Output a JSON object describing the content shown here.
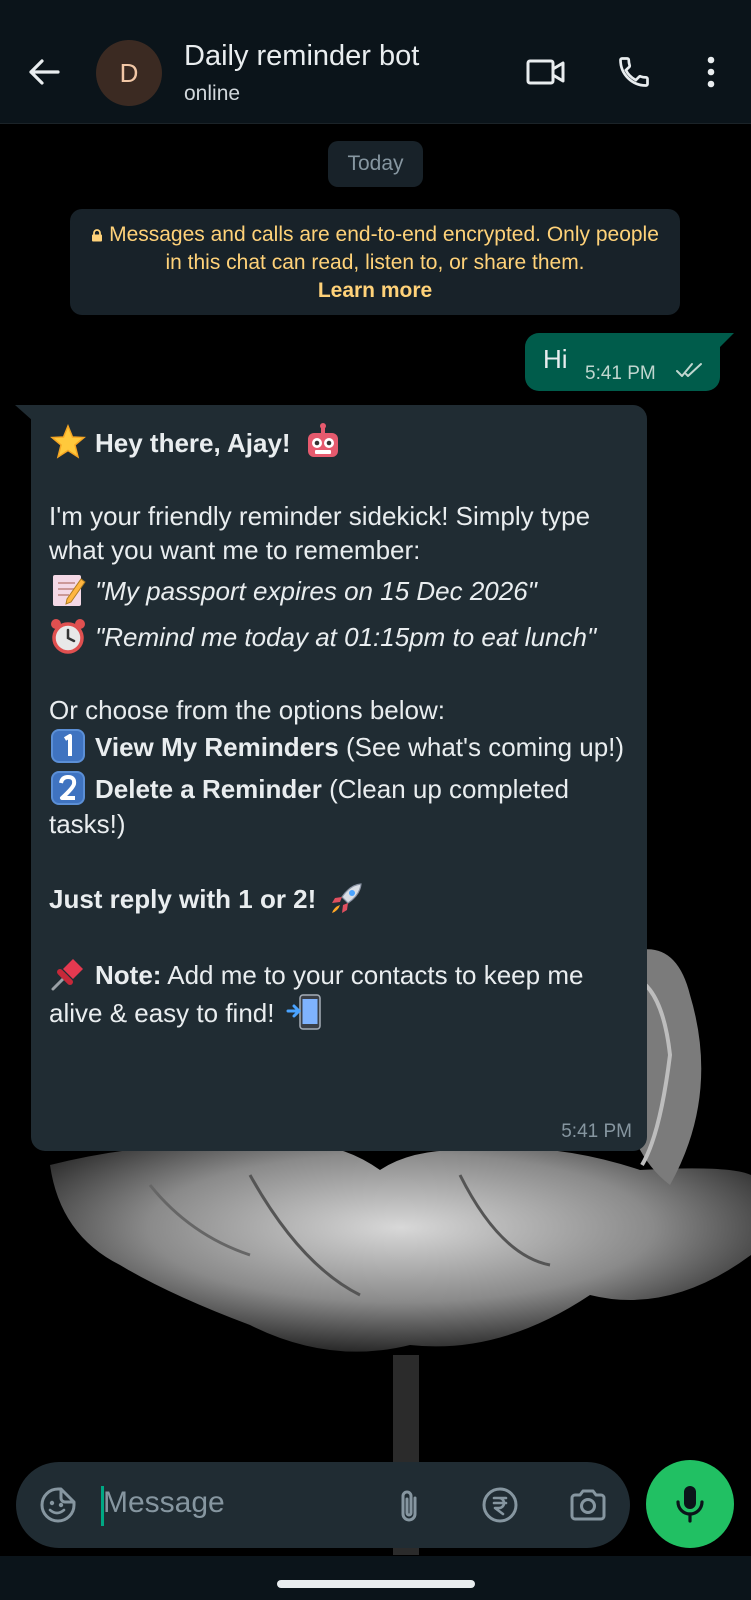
{
  "header": {
    "avatar_letter": "D",
    "title": "Daily reminder bot",
    "status": "online",
    "icons": [
      "back-arrow-icon",
      "video-call-icon",
      "phone-call-icon",
      "more-vertical-icon"
    ]
  },
  "chat": {
    "day_chip": "Today",
    "encryption_notice": "Messages and calls are end-to-end encrypted. Only people in this chat can read, listen to, or share them.",
    "encryption_link": "Learn more",
    "outgoing": {
      "text": "Hi",
      "time": "5:41 PM",
      "status": "read"
    },
    "incoming": {
      "greeting": "Hey there, Ajay!",
      "intro": "I'm your friendly reminder sidekick! Simply type what you want me to remember:",
      "example1": "\"My passport expires on 15 Dec 2026\"",
      "example2": "\"Remind me today at 01:15pm to eat lunch\"",
      "options_intro": "Or choose from the options below:",
      "option1_bold": "View My Reminders",
      "option1_rest": " (See what's coming up!)",
      "option2_bold": "Delete a Reminder",
      "option2_rest": " (Clean up completed tasks!)",
      "reply_hint": "Just reply with 1 or 2!",
      "note_label": "Note:",
      "note_text": " Add me to your contacts to keep me alive & easy to find!",
      "time": "5:41 PM"
    }
  },
  "composer": {
    "placeholder": "Message",
    "icons": [
      "sticker-icon",
      "attach-icon",
      "rupee-payment-icon",
      "camera-icon",
      "mic-icon"
    ]
  },
  "colors": {
    "header_bg": "#0b141a",
    "incoming_bubble": "#202c33",
    "outgoing_bubble": "#005c4b",
    "accent_green": "#21c063",
    "notice_text": "#ffd279"
  }
}
